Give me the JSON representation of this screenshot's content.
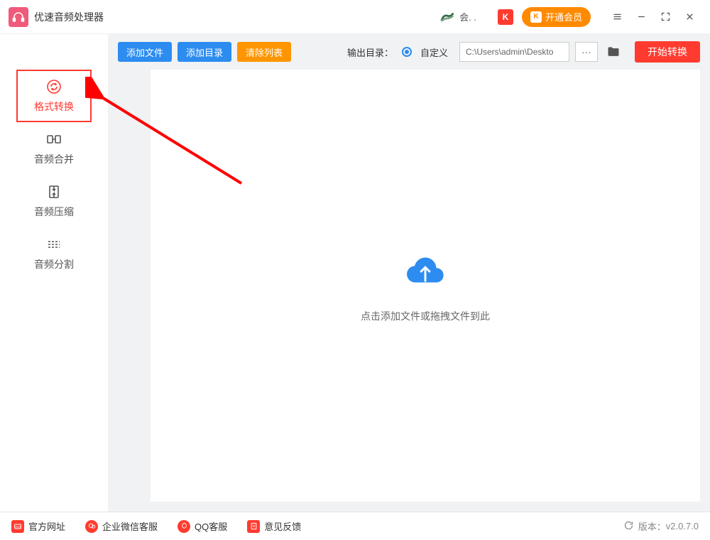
{
  "titlebar": {
    "app_name": "优速音频处理器",
    "user": "会. .",
    "k_badge": "K",
    "vip_label": "开通会员",
    "vip_k": "K"
  },
  "sidebar": {
    "items": [
      {
        "label": "格式转换"
      },
      {
        "label": "音频合并"
      },
      {
        "label": "音频压缩"
      },
      {
        "label": "音频分割"
      }
    ]
  },
  "toolbar": {
    "add_file": "添加文件",
    "add_dir": "添加目录",
    "clear_list": "清除列表",
    "out_label": "输出目录：",
    "radio_custom": "自定义",
    "out_path": "C:\\Users\\admin\\Deskto",
    "more": "···",
    "start": "开始转换"
  },
  "dropzone": {
    "text": "点击添加文件或拖拽文件到此"
  },
  "footer": {
    "links": [
      {
        "label": "官方网址"
      },
      {
        "label": "企业微信客服"
      },
      {
        "label": "QQ客服"
      },
      {
        "label": "意见反馈"
      }
    ],
    "version_label": "版本：",
    "version": "v2.0.7.0"
  }
}
